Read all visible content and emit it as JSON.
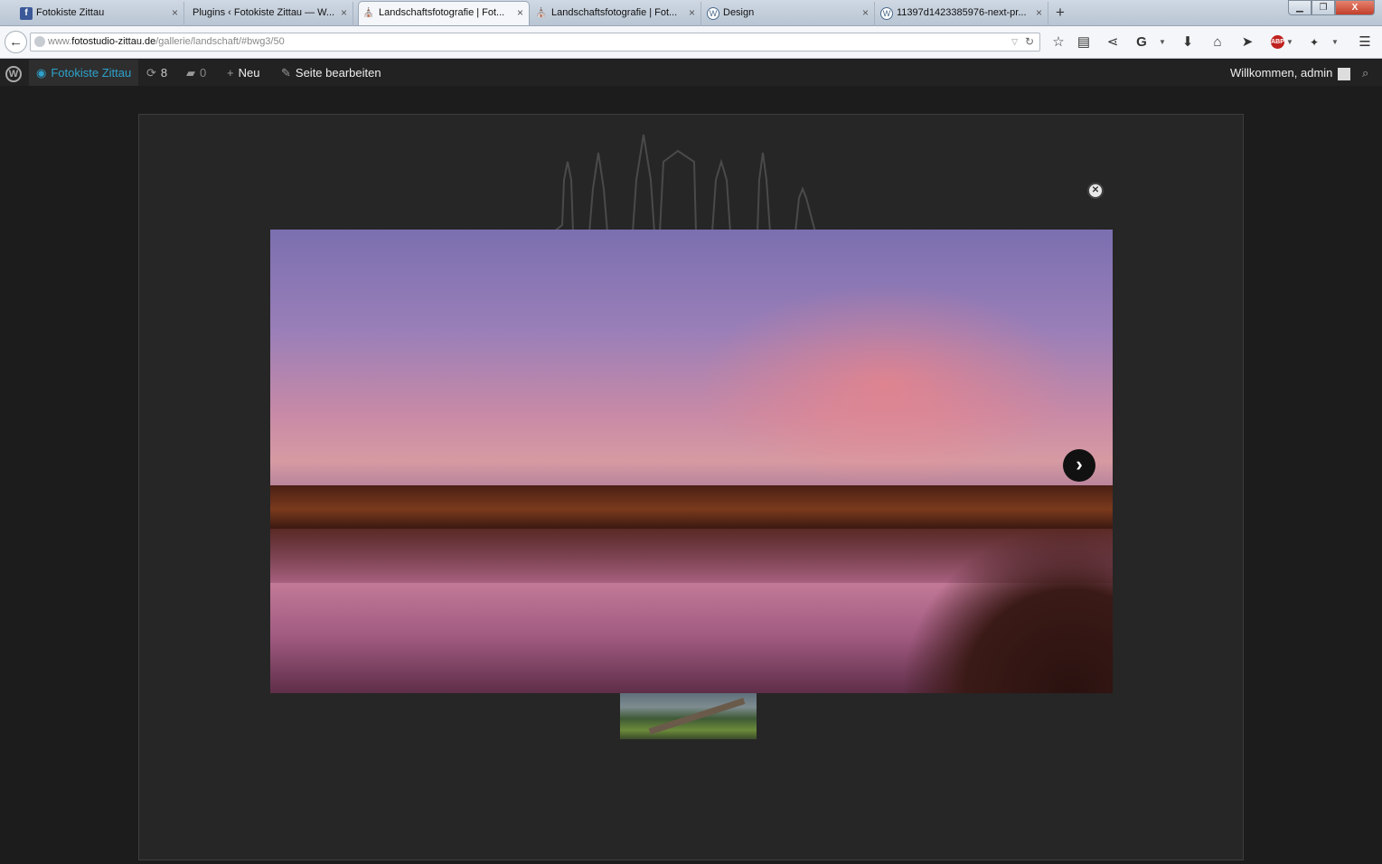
{
  "browser": {
    "tabs": [
      {
        "title": "Fotokiste Zittau",
        "favicon": "facebook-icon",
        "active": false
      },
      {
        "title": "Plugins ‹ Fotokiste Zittau — W...",
        "favicon": "none",
        "active": false
      },
      {
        "title": "Landschaftsfotografie | Fot...",
        "favicon": "skyline-icon",
        "active": true
      },
      {
        "title": "Landschaftsfotografie | Fot...",
        "favicon": "skyline-icon",
        "active": false
      },
      {
        "title": "Design",
        "favicon": "wordpress-icon",
        "active": false
      },
      {
        "title": "11397d1423385976-next-pr...",
        "favicon": "wordpress-icon",
        "active": false
      }
    ],
    "tab_close_glyph": "×",
    "new_tab_glyph": "+",
    "window_buttons": {
      "minimize": "▁",
      "maximize": "❐",
      "close": "X"
    },
    "url": {
      "prefix": "www.",
      "domain": "fotostudio-zittau.de",
      "path": "/gallerie/landschaft/#bwg3/50"
    },
    "toolbar_icons": [
      "star-icon",
      "reader-icon",
      "share-icon",
      "search-g-icon",
      "download-icon",
      "home-icon",
      "send-icon",
      "adblock-icon",
      "extension-icon",
      "menu-icon"
    ]
  },
  "wp_admin_bar": {
    "site_name": "Fotokiste Zittau",
    "updates_count": "8",
    "comments_count": "0",
    "new_label": "Neu",
    "edit_label": "Seite bearbeiten",
    "greeting": "Willkommen, admin"
  },
  "lightbox": {
    "close_glyph": "✕",
    "next_glyph": "›",
    "image_description": "Sunset over lake with autumn forest",
    "thumbnail_description": "Fallen tree in forest"
  },
  "colors": {
    "admin_bar": "#222222",
    "site_link": "#2ea2cc",
    "page_bg": "#1c1c1c",
    "panel_bg": "#262626"
  }
}
